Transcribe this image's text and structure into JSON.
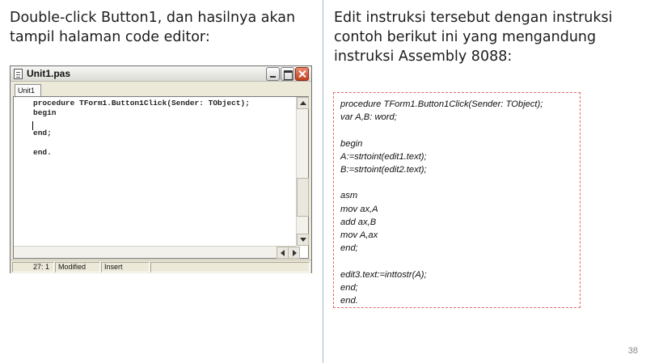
{
  "left_heading": {
    "line1": "Double-click Button1, dan hasilnya akan",
    "line2": "tampil halaman code editor:"
  },
  "right_heading": {
    "line1": "Edit instruksi tersebut dengan instruksi",
    "line2": "contoh berikut ini yang mengandung",
    "line3": "instruksi Assembly 8088:"
  },
  "window": {
    "title": "Unit1.pas",
    "tab_label": "Unit1",
    "code_lines": [
      "procedure TForm1.Button1Click(Sender: TObject);",
      "begin",
      "",
      "end;",
      "",
      "end."
    ],
    "status": {
      "position": "27:  1",
      "modified": "Modified",
      "mode": "Insert",
      "extra": ""
    }
  },
  "code_example": {
    "lines": [
      "procedure TForm1.Button1Click(Sender: TObject);",
      "var A,B: word;",
      "",
      "begin",
      "A:=strtoint(edit1.text);",
      "B:=strtoint(edit2.text);",
      "",
      "asm",
      "mov ax,A",
      "add ax,B",
      "mov A,ax",
      "end;",
      "",
      "edit3.text:=inttostr(A);",
      "end;",
      "end."
    ]
  },
  "slide_number": "38"
}
